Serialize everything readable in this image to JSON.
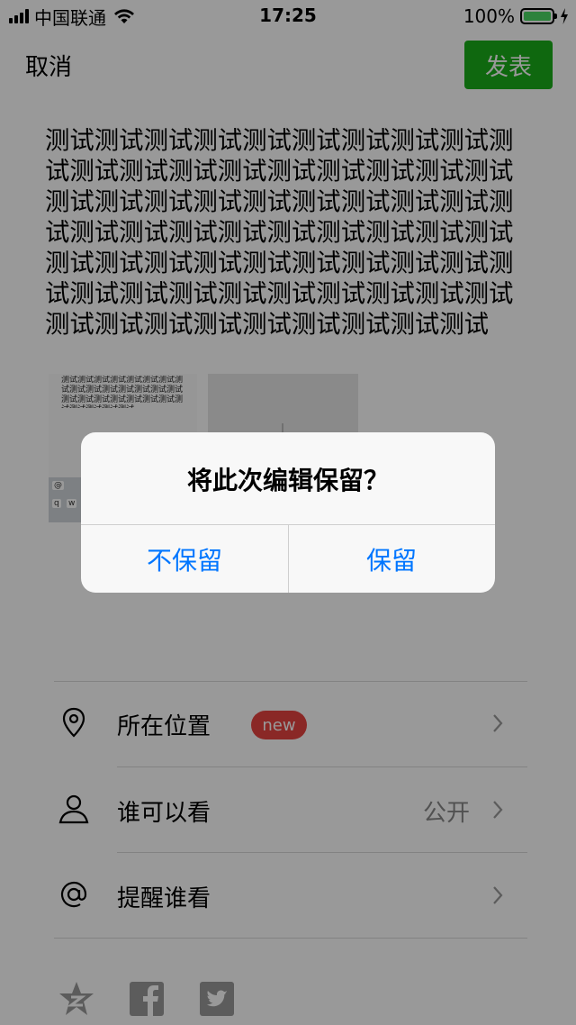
{
  "status_bar": {
    "carrier": "中国联通",
    "time": "17:25",
    "battery_percent": "100%",
    "battery_level": 1.0,
    "icons": [
      "signal-icon",
      "wifi-icon",
      "battery-icon",
      "charging-icon"
    ]
  },
  "header": {
    "cancel_label": "取消",
    "publish_label": "发表",
    "accent_color": "#1aad19"
  },
  "post": {
    "text": "测试测试测试测试测试测试测试测试测试测试测试测试测试测试测试测试测试测试测试测试测试测试测试测试测试测试测试测试测试测试测试测试测试测试测试测试测试测试测试测试测试测试测试测试测试测试测试测试测试测试测试测试测试测试测试测试测试测试测试测试测试测试测试测试测试测试",
    "thumbnail_text": "测试测试测试测试测试测试测试测试测试测试测试测试测试测试测试测试测试测试测试测试测试测试测试测试测试测试测试"
  },
  "options": [
    {
      "label": "所在位置",
      "badge": "new",
      "value": "",
      "icon": "location-icon"
    },
    {
      "label": "谁可以看",
      "badge": "",
      "value": "公开",
      "icon": "person-icon"
    },
    {
      "label": "提醒谁看",
      "badge": "",
      "value": "",
      "icon": "at-icon"
    }
  ],
  "share_icons": [
    "qzone-icon",
    "facebook-icon",
    "twitter-icon"
  ],
  "dialog": {
    "title": "将此次编辑保留？",
    "discard_label": "不保留",
    "keep_label": "保留",
    "button_color": "#0076ff"
  }
}
